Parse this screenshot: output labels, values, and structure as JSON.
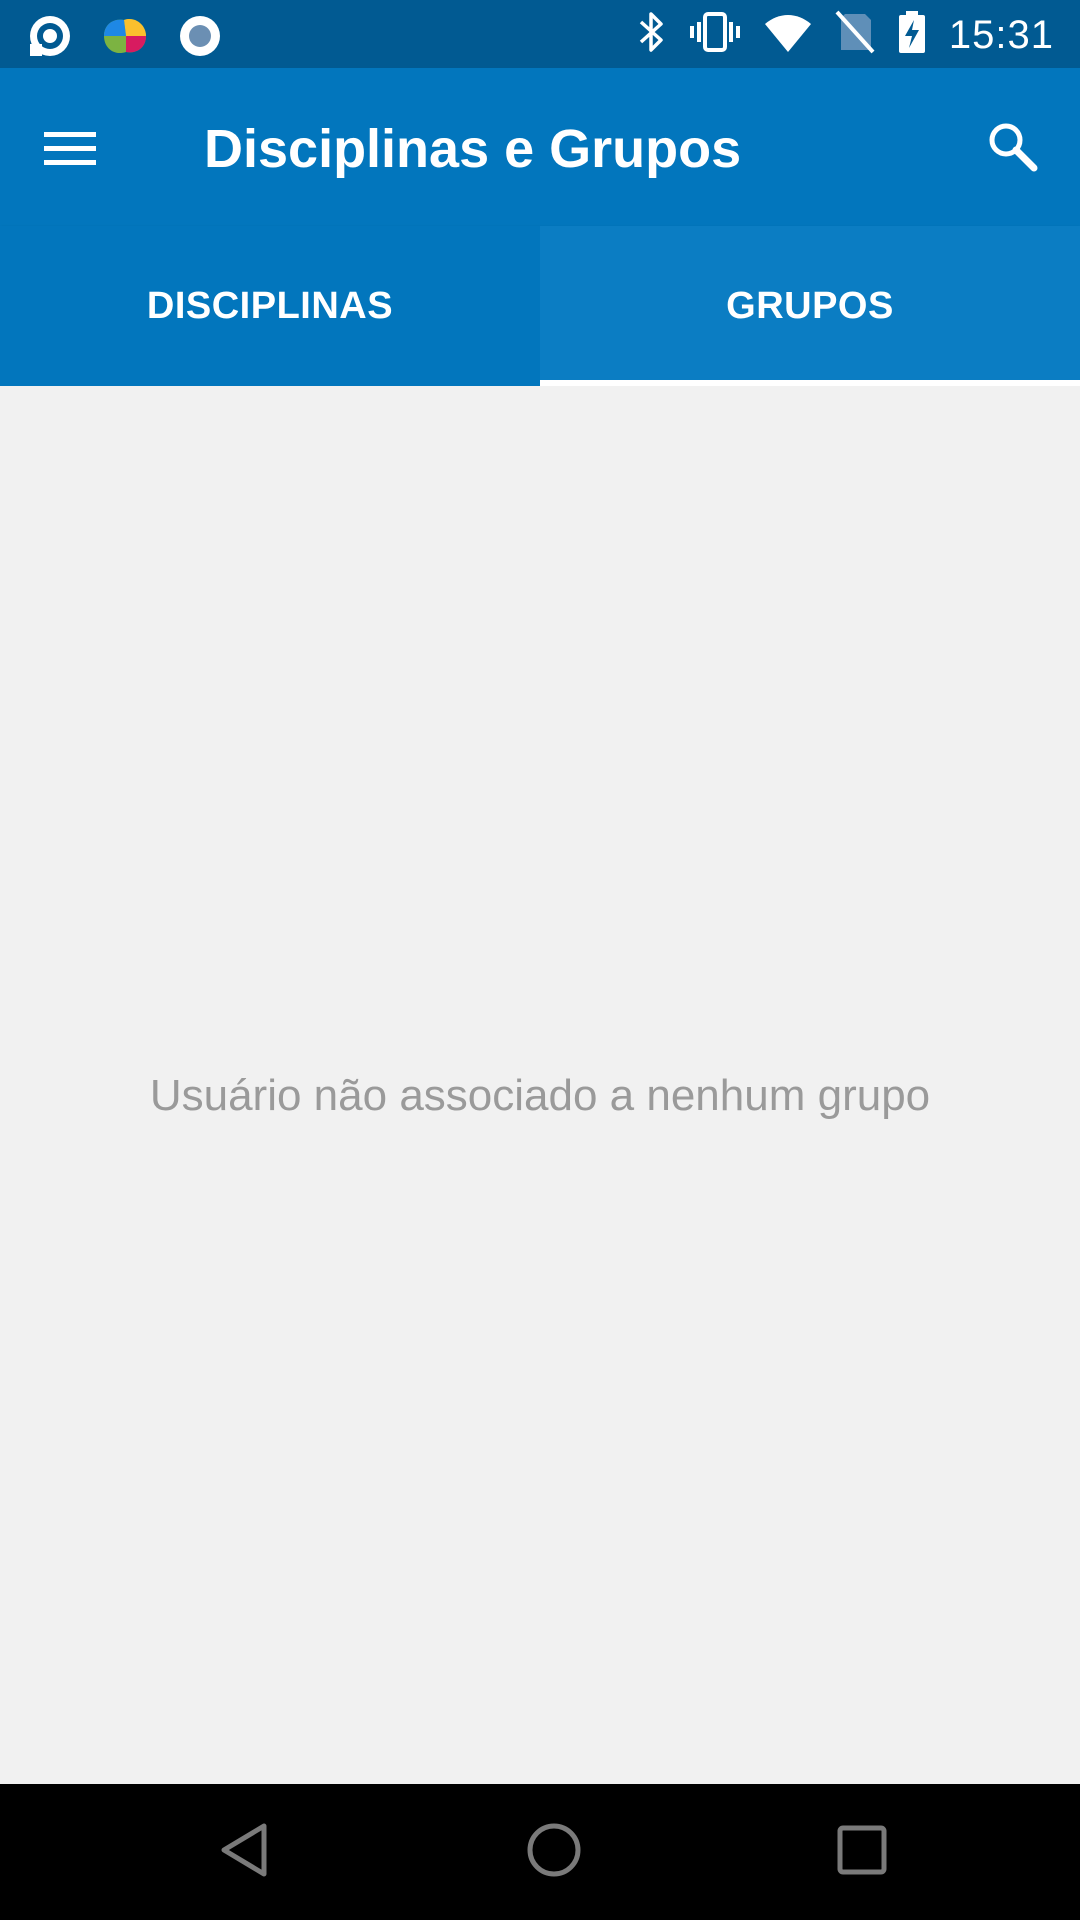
{
  "status_bar": {
    "time": "15:31",
    "left_icons": [
      "notification-app-icon",
      "puzzle-brain-app-icon",
      "record-circle-icon"
    ],
    "right_icons": [
      "bluetooth-icon",
      "vibrate-icon",
      "wifi-icon",
      "no-sim-icon",
      "battery-charging-icon"
    ]
  },
  "app_bar": {
    "title": "Disciplinas e Grupos",
    "menu_icon": "hamburger-menu-icon",
    "search_icon": "search-icon"
  },
  "tabs": [
    {
      "label": "DISCIPLINAS",
      "selected": false
    },
    {
      "label": "GRUPOS",
      "selected": true
    }
  ],
  "content": {
    "empty_message": "Usuário não associado a nenhum grupo"
  },
  "nav_bar": {
    "icons": [
      "back-icon",
      "home-icon",
      "recents-icon"
    ]
  },
  "colors": {
    "status_bar": "#015a92",
    "app_bar": "#0276bd",
    "tab_selected": "#0b7dc3",
    "indicator": "#ffffff",
    "background": "#f1f1f1",
    "empty_text": "#9a9a9a"
  }
}
